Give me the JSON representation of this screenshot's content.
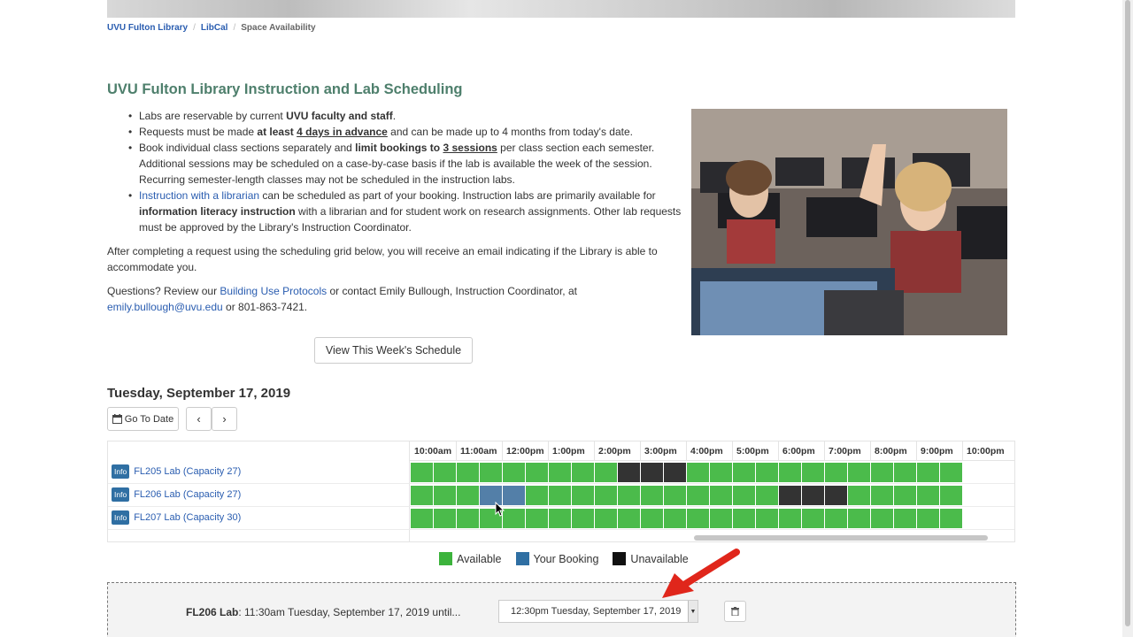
{
  "breadcrumb": {
    "items": [
      "UVU Fulton Library",
      "LibCal"
    ],
    "current": "Space Availability"
  },
  "page": {
    "title": "UVU Fulton Library Instruction and Lab Scheduling"
  },
  "intro": {
    "b1": {
      "pre": "Labs are reservable by current ",
      "bold": "UVU faculty and staff",
      "post": "."
    },
    "b2": {
      "pre": "Requests must be made ",
      "bold1": "at least ",
      "bold2": "4 days in advance",
      "post": " and can be made up to 4 months from today's date."
    },
    "b3": {
      "pre": "Book individual class sections separately and ",
      "bold1": "limit bookings to ",
      "bold2": "3 sessions",
      "post": " per class section each semester. Additional sessions may be scheduled on a case-by-case basis if the lab is available the week of the session. Recurring semester-length classes may not be scheduled in the instruction labs."
    },
    "b4": {
      "link": "Instruction with a librarian",
      "mid": " can be scheduled as part of your booking. Instruction labs are primarily available for ",
      "bold": "information literacy instruction",
      "post": " with a librarian and for student work on research assignments. Other lab requests must be approved by the Library's Instruction Coordinator."
    },
    "p1": "After completing a request using the scheduling grid below, you will receive an email indicating if the Library is able to accommodate you.",
    "p2": {
      "pre": "Questions? Review our ",
      "link": "Building Use Protocols",
      "mid": " or contact Emily Bullough, Instruction Coordinator, at ",
      "email": "emily.bullough@uvu.edu",
      "post": " or 801-863-7421."
    }
  },
  "buttons": {
    "week": "View This Week's Schedule",
    "goto": "Go To Date",
    "prev": "‹",
    "next": "›"
  },
  "icons": {
    "calendar": "calendar-icon",
    "trash": "trash-icon",
    "dropdown": "chevron-down-icon",
    "arrow": "red-arrow-annotation",
    "cursor": "mouse-pointer"
  },
  "schedule": {
    "date": "Tuesday, September 17, 2019",
    "hours": [
      "10:00am",
      "11:00am",
      "12:00pm",
      "1:00pm",
      "2:00pm",
      "3:00pm",
      "4:00pm",
      "5:00pm",
      "6:00pm",
      "7:00pm",
      "8:00pm",
      "9:00pm",
      "10:00pm"
    ],
    "info_label": "Info",
    "rooms": [
      {
        "name": "FL205 Lab (Capacity 27)",
        "slots": [
          "a",
          "a",
          "a",
          "a",
          "a",
          "a",
          "a",
          "a",
          "a",
          "u",
          "u",
          "u",
          "a",
          "a",
          "a",
          "a",
          "a",
          "a",
          "a",
          "a",
          "a",
          "a",
          "a",
          "a"
        ]
      },
      {
        "name": "FL206 Lab (Capacity 27)",
        "slots": [
          "a",
          "a",
          "a",
          "b",
          "b",
          "a",
          "a",
          "a",
          "a",
          "a",
          "a",
          "a",
          "a",
          "a",
          "a",
          "a",
          "u",
          "u",
          "u",
          "a",
          "a",
          "a",
          "a",
          "a"
        ]
      },
      {
        "name": "FL207 Lab (Capacity 30)",
        "slots": [
          "a",
          "a",
          "a",
          "a",
          "a",
          "a",
          "a",
          "a",
          "a",
          "a",
          "a",
          "a",
          "a",
          "a",
          "a",
          "a",
          "a",
          "a",
          "a",
          "a",
          "a",
          "a",
          "a",
          "a"
        ]
      }
    ]
  },
  "legend": {
    "available": "Available",
    "booking": "Your Booking",
    "unavailable": "Unavailable"
  },
  "colors": {
    "available": "#4bbb4b",
    "booking": "#537fa8",
    "unavailable": "#333333",
    "title": "#4e7f6c",
    "link": "#2a5db0"
  },
  "booking": {
    "room": "FL206 Lab",
    "text": ": 11:30am Tuesday, September 17, 2019 until...",
    "end_time": "12:30pm Tuesday, September 17, 2019"
  }
}
